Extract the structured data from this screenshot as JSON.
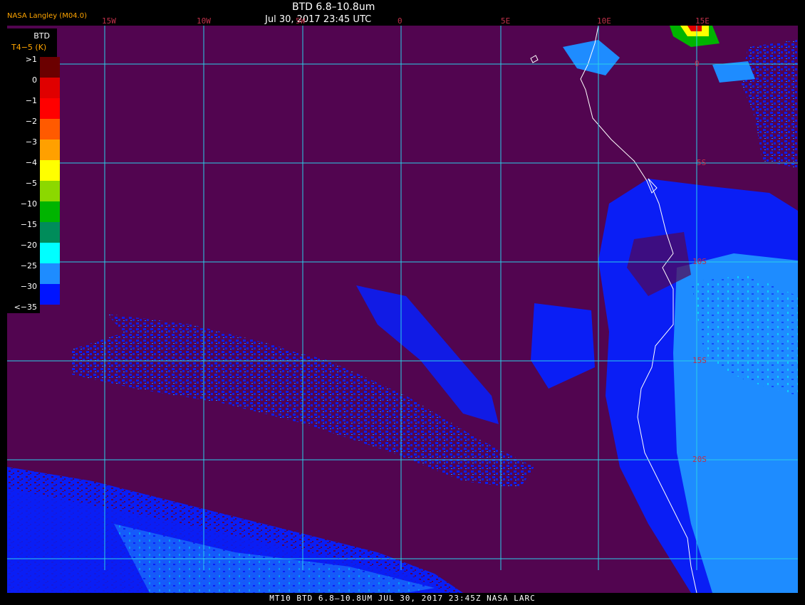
{
  "header": {
    "org": "NASA Langley (M04.0)",
    "title": "BTD 6.8–10.8um",
    "datetime": "Jul 30, 2017 23:45 UTC"
  },
  "legend": {
    "title": "BTD",
    "subtitle": "T4−5 (K)",
    "entries": [
      {
        "label": ">1",
        "color": "#6b0000"
      },
      {
        "label": "0",
        "color": "#e00000"
      },
      {
        "label": "−1",
        "color": "#ff0000"
      },
      {
        "label": "−2",
        "color": "#ff5a00"
      },
      {
        "label": "−3",
        "color": "#ffa000"
      },
      {
        "label": "−4",
        "color": "#ffff00"
      },
      {
        "label": "−5",
        "color": "#8cd800"
      },
      {
        "label": "−10",
        "color": "#00b400"
      },
      {
        "label": "−15",
        "color": "#008c5a"
      },
      {
        "label": "−20",
        "color": "#00ffff"
      },
      {
        "label": "−25",
        "color": "#1e8cff"
      },
      {
        "label": "−30",
        "color": "#0014ff"
      },
      {
        "label": "<−35",
        "color": "#520550"
      }
    ]
  },
  "grid": {
    "longitudes": [
      "15W",
      "10W",
      "5W",
      "0",
      "5E",
      "10E",
      "15E"
    ],
    "latitudes": [
      "0",
      "5S",
      "10S",
      "15S",
      "20S"
    ],
    "line_color": "#2ad0e8"
  },
  "footer": {
    "text": "MT10  BTD 6.8–10.8UM  JUL 30, 2017 23:45Z  NASA LARC"
  },
  "colors": {
    "background": "#520550",
    "cloud_blue": "#0a1ef5",
    "cloud_light": "#1e8cff",
    "cloud_cyan": "#00ffff",
    "coastline": "#ffffff"
  }
}
